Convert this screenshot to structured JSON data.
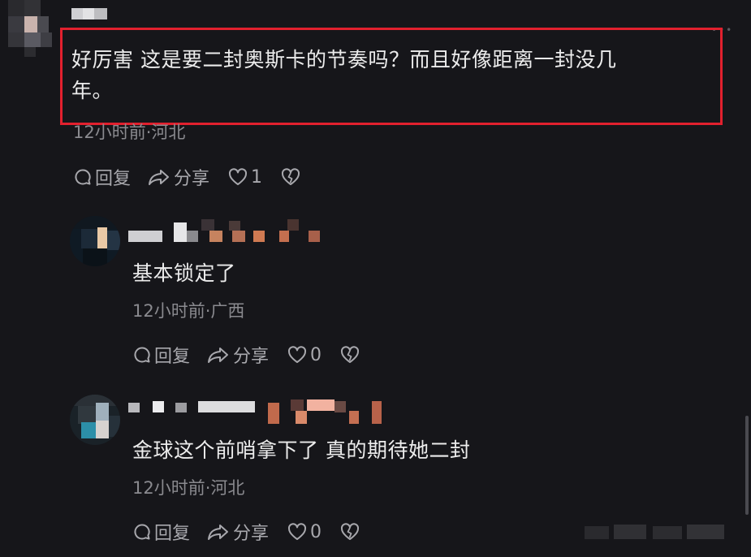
{
  "comments": [
    {
      "text": "好厉害 这是要二封奥斯卡的节奏吗？而且好像距离一封没几年。",
      "text_line1": "好厉害 这是要二封奥斯卡的节奏吗？而且好像距离一封没几",
      "text_line2": "年。",
      "meta": "12小时前·河北",
      "reply_label": "回复",
      "share_label": "分享",
      "like_count": "1",
      "highlighted": true
    },
    {
      "text": "基本锁定了",
      "meta": "12小时前·广西",
      "reply_label": "回复",
      "share_label": "分享",
      "like_count": "0"
    },
    {
      "text": "金球这个前哨拿下了 真的期待她二封",
      "meta": "12小时前·河北",
      "reply_label": "回复",
      "share_label": "分享",
      "like_count": "0"
    }
  ],
  "colors": {
    "background": "#16161a",
    "highlight_border": "#e2202e",
    "text_primary": "#ececec",
    "text_meta": "#8a8a8f",
    "text_action": "#a8a8ad"
  },
  "icons": [
    "comment-icon",
    "share-icon",
    "heart-icon",
    "broken-heart-icon"
  ]
}
